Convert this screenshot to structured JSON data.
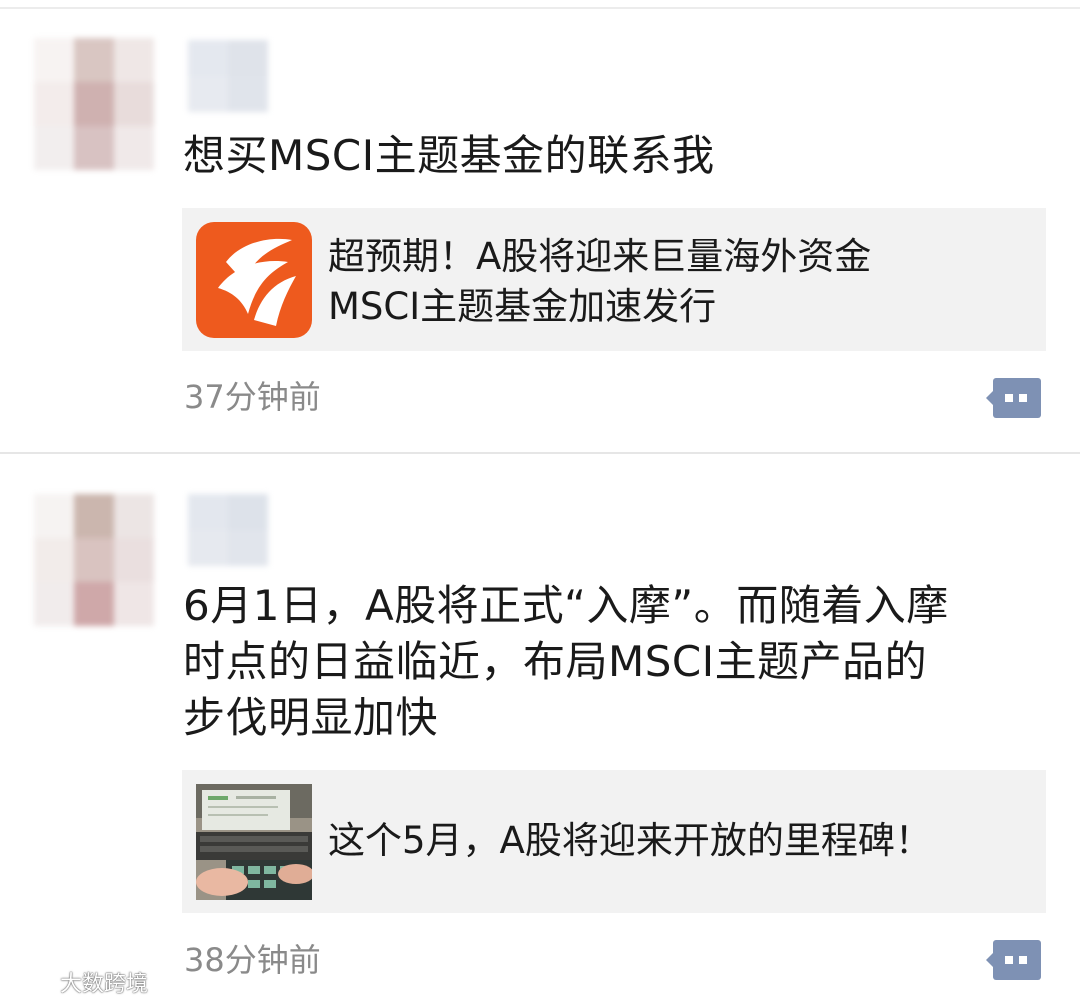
{
  "posts": [
    {
      "text": "想买MSCI主题基金的联系我",
      "share": {
        "title_line1": "超预期！A股将迎来巨量海外资金",
        "title_line2": "MSCI主题基金加速发行",
        "thumb_icon": "orange-fund-app-logo"
      },
      "time": "37分钟前"
    },
    {
      "text_lines": [
        "6月1日，A股将正式“入摩”。而随着入摩",
        "时点的日益临近，布局MSCI主题产品的",
        "步伐明显加快"
      ],
      "share": {
        "title": "这个5月，A股将迎来开放的里程碑！",
        "thumb_icon": "calculator-laptop-photo"
      },
      "time": "38分钟前"
    }
  ],
  "watermark": {
    "text": "大数跨境",
    "icon": "weibo-logo-icon"
  },
  "colors": {
    "card_bg": "#f2f2f2",
    "time_text": "#8a8a8a",
    "comment_icon": "#7e91b4",
    "logo_orange": "#ee5a1e"
  }
}
